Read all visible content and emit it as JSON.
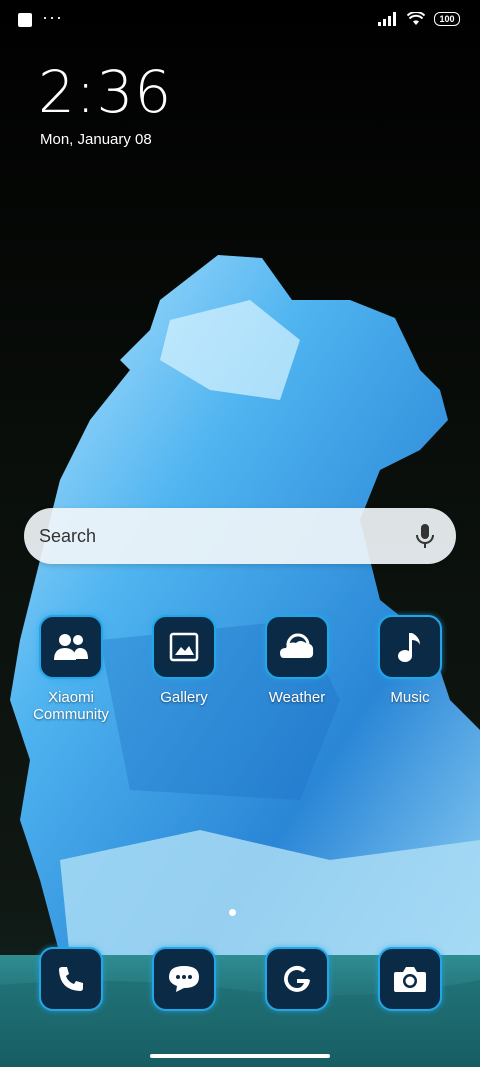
{
  "status_bar": {
    "notification_icons": [
      "square-icon",
      "more-dots-icon"
    ],
    "signal_icon": "signal-bars-icon",
    "wifi_icon": "wifi-icon",
    "battery_level": "100"
  },
  "clock": {
    "time": "2:36",
    "date": "Mon, January 08"
  },
  "search": {
    "placeholder": "Search",
    "icon": "mic-icon"
  },
  "apps": [
    {
      "label": "Xiaomi Community",
      "icon": "community-icon"
    },
    {
      "label": "Gallery",
      "icon": "gallery-icon"
    },
    {
      "label": "Weather",
      "icon": "weather-icon"
    },
    {
      "label": "Music",
      "icon": "music-icon"
    }
  ],
  "dock": [
    {
      "icon": "phone-icon"
    },
    {
      "icon": "messages-icon"
    },
    {
      "icon": "google-icon"
    },
    {
      "icon": "camera-icon"
    }
  ],
  "colors": {
    "accent": "#23a6e8",
    "icon_bg": "#0b2a45"
  }
}
